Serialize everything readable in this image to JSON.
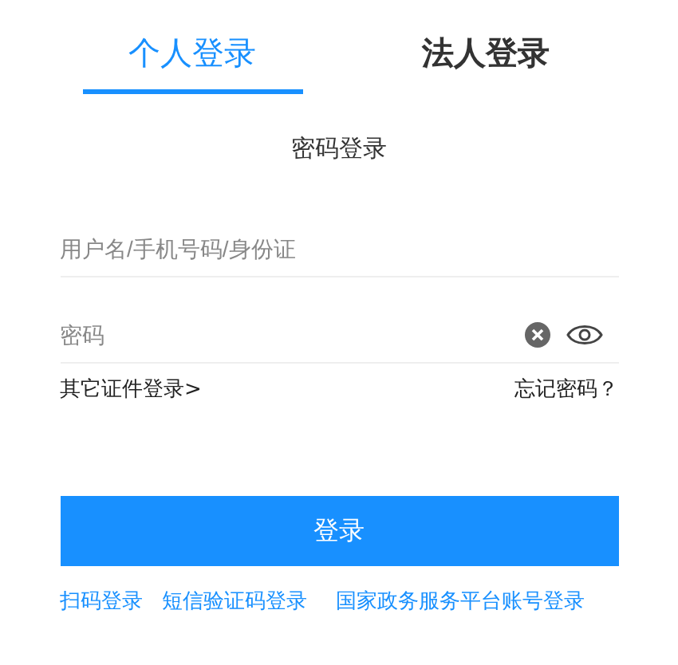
{
  "tabs": [
    {
      "label": "个人登录",
      "selected": true
    },
    {
      "label": "法人登录",
      "selected": false
    }
  ],
  "heading": "密码登录",
  "username": {
    "placeholder": "用户名/手机号码/身份证"
  },
  "password": {
    "placeholder": "密码"
  },
  "other_login": "其它证件登录>",
  "forgot": "忘记密码？",
  "submit": "登录",
  "alt_links": [
    "扫码登录",
    "短信验证码登录",
    "国家政务服务平台账号登录"
  ]
}
